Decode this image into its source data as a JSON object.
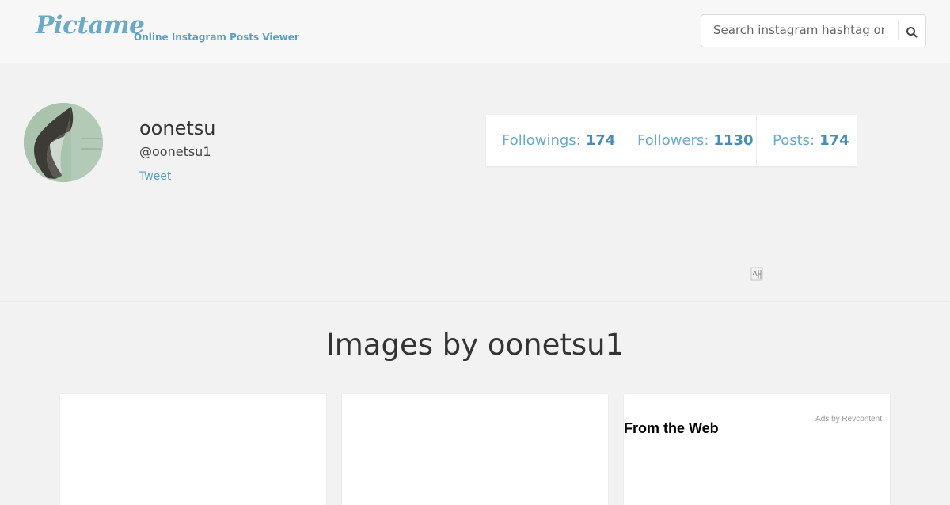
{
  "header": {
    "logo": "Pictame",
    "tagline": "Online Instagram Posts Viewer",
    "search": {
      "placeholder": "Search instagram hashtag or user",
      "icon": "search-icon"
    }
  },
  "profile": {
    "name": "oonetsu",
    "handle": "@oonetsu1",
    "tweet_label": "Tweet",
    "avatar": "avatar-image"
  },
  "stats": {
    "followings": {
      "label": "Followings:",
      "value": "174"
    },
    "followers": {
      "label": "Followers:",
      "value": "1130"
    },
    "posts": {
      "label": "Posts:",
      "value": "174"
    }
  },
  "gallery": {
    "title": "Images by oonetsu1"
  },
  "ad": {
    "ads_by": "Ads by Revcontent",
    "heading": "From the Web",
    "icon": "ad-choices-icon"
  },
  "colors": {
    "accent": "#6aa9c8",
    "accent_dark": "#4a8db4",
    "background": "#f2f2f2"
  }
}
